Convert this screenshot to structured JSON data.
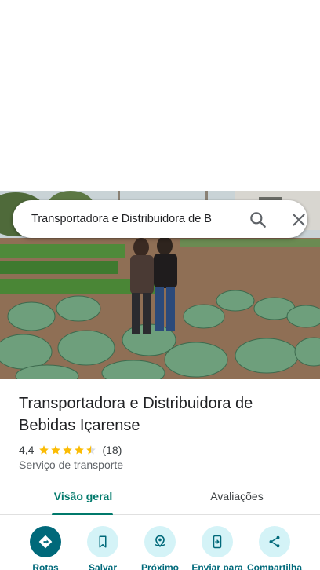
{
  "search": {
    "query": "Transportadora e Distribuidora de B",
    "search_icon": "search-icon",
    "close_icon": "close-icon"
  },
  "place": {
    "name": "Transportadora e Distribuidora de Bebidas Içarense",
    "rating": "4,4",
    "rating_value": 4.4,
    "review_count": "(18)",
    "category": "Serviço de transporte"
  },
  "tabs": [
    {
      "label": "Visão geral",
      "selected": true
    },
    {
      "label": "Avaliações",
      "selected": false
    }
  ],
  "actions": [
    {
      "label": "Rotas",
      "icon": "directions-icon"
    },
    {
      "label": "Salvar",
      "icon": "bookmark-icon"
    },
    {
      "label": "Próximo",
      "icon": "nearby-icon"
    },
    {
      "label": "Enviar para",
      "icon": "send-to-phone-icon"
    },
    {
      "label": "Compartilha",
      "icon": "share-icon"
    }
  ],
  "colors": {
    "accent": "#00796b",
    "action_primary": "#00697a",
    "action_bg": "#d4f3f7",
    "star": "#fbbc04"
  }
}
